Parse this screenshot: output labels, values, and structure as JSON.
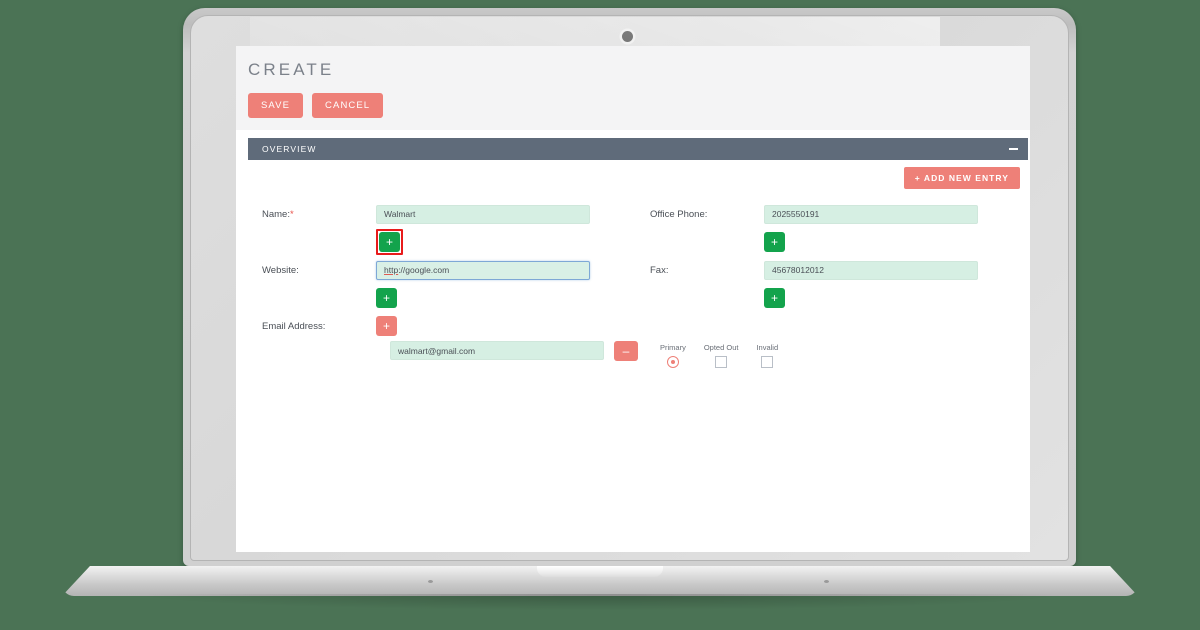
{
  "app": {
    "page_title": "CREATE",
    "save_label": "SAVE",
    "cancel_label": "CANCEL",
    "section_title": "OVERVIEW",
    "collapse_icon": "minus-icon",
    "add_new_entry_label": "+ ADD NEW ENTRY"
  },
  "form": {
    "name": {
      "label": "Name:",
      "required_mark": "*",
      "value": "Walmart",
      "add_button": "+"
    },
    "website": {
      "label": "Website:",
      "value_prefix": "http",
      "value_suffix": "://google.com",
      "value": "http://google.com",
      "add_button": "+"
    },
    "email": {
      "label": "Email Address:",
      "add_button": "+",
      "value": "walmart@gmail.com",
      "remove_button": "–",
      "options": [
        {
          "label": "Primary",
          "type": "radio",
          "checked": true
        },
        {
          "label": "Opted Out",
          "type": "checkbox",
          "checked": false
        },
        {
          "label": "Invalid",
          "type": "checkbox",
          "checked": false
        }
      ]
    },
    "office_phone": {
      "label": "Office Phone:",
      "value": "2025550191",
      "add_button": "+"
    },
    "fax": {
      "label": "Fax:",
      "value": "45678012012",
      "add_button": "+"
    }
  },
  "colors": {
    "background": "#4b7355",
    "coral": "#ee8078",
    "green": "#13a34c",
    "slate": "#5f6b7a",
    "input_bg": "#d6efe3",
    "highlight": "#e81b1b"
  }
}
